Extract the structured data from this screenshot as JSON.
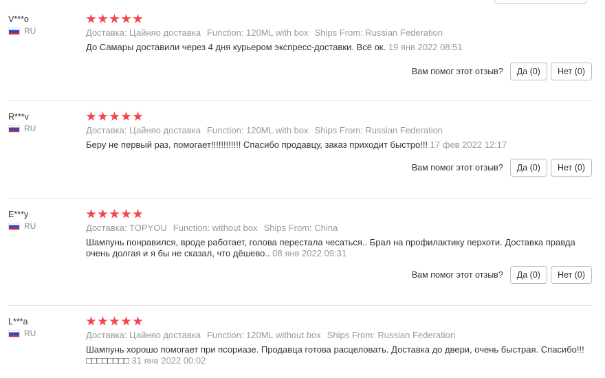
{
  "helpful_prompt": "Вам помог этот отзыв?",
  "reviews": [
    {
      "author": "V***o",
      "country": "RU",
      "rating": 5,
      "meta": [
        "Доставка: Цайняо доставка",
        "Function: 120ML with box",
        "Ships From: Russian Federation"
      ],
      "text": "До Самары доставили через 4 дня курьером экспресс-доставки. Всё ок.",
      "date": "19 янв 2022 08:51",
      "yes": "Да (0)",
      "no": "Нет (0)"
    },
    {
      "author": "R***v",
      "country": "RU",
      "rating": 5,
      "meta": [
        "Доставка: Цайняо доставка",
        "Function: 120ML with box",
        "Ships From: Russian Federation"
      ],
      "text": "Беру не первый раз, помогает!!!!!!!!!!!! Спасибо продавцу, заказ приходит быстро!!!",
      "date": "17 фев 2022 12:17",
      "yes": "Да (0)",
      "no": "Нет (0)"
    },
    {
      "author": "E***y",
      "country": "RU",
      "rating": 5,
      "meta": [
        "Доставка: TOPYOU",
        "Function: without box",
        "Ships From: China"
      ],
      "text": "Шампунь понравился, вроде работает, голова перестала чесаться.. Брал на профилактику перхоти. Доставка правда очень долгая и я бы не сказал, что дёшево..",
      "date": "08 янв 2022 09:31",
      "yes": "Да (0)",
      "no": "Нет (0)"
    },
    {
      "author": "L***a",
      "country": "RU",
      "rating": 5,
      "meta": [
        "Доставка: Цайняо доставка",
        "Function: 120ML without box",
        "Ships From: Russian Federation"
      ],
      "text": "Шампунь хорошо помогает при псориазе. Продавца готова расцеловать. Доставка до двери, очень быстрая. Спасибо!!!□□□□□□□□",
      "date": "31 янв 2022 00:02",
      "yes": "Да (0)",
      "no": "Нет (0)"
    }
  ]
}
